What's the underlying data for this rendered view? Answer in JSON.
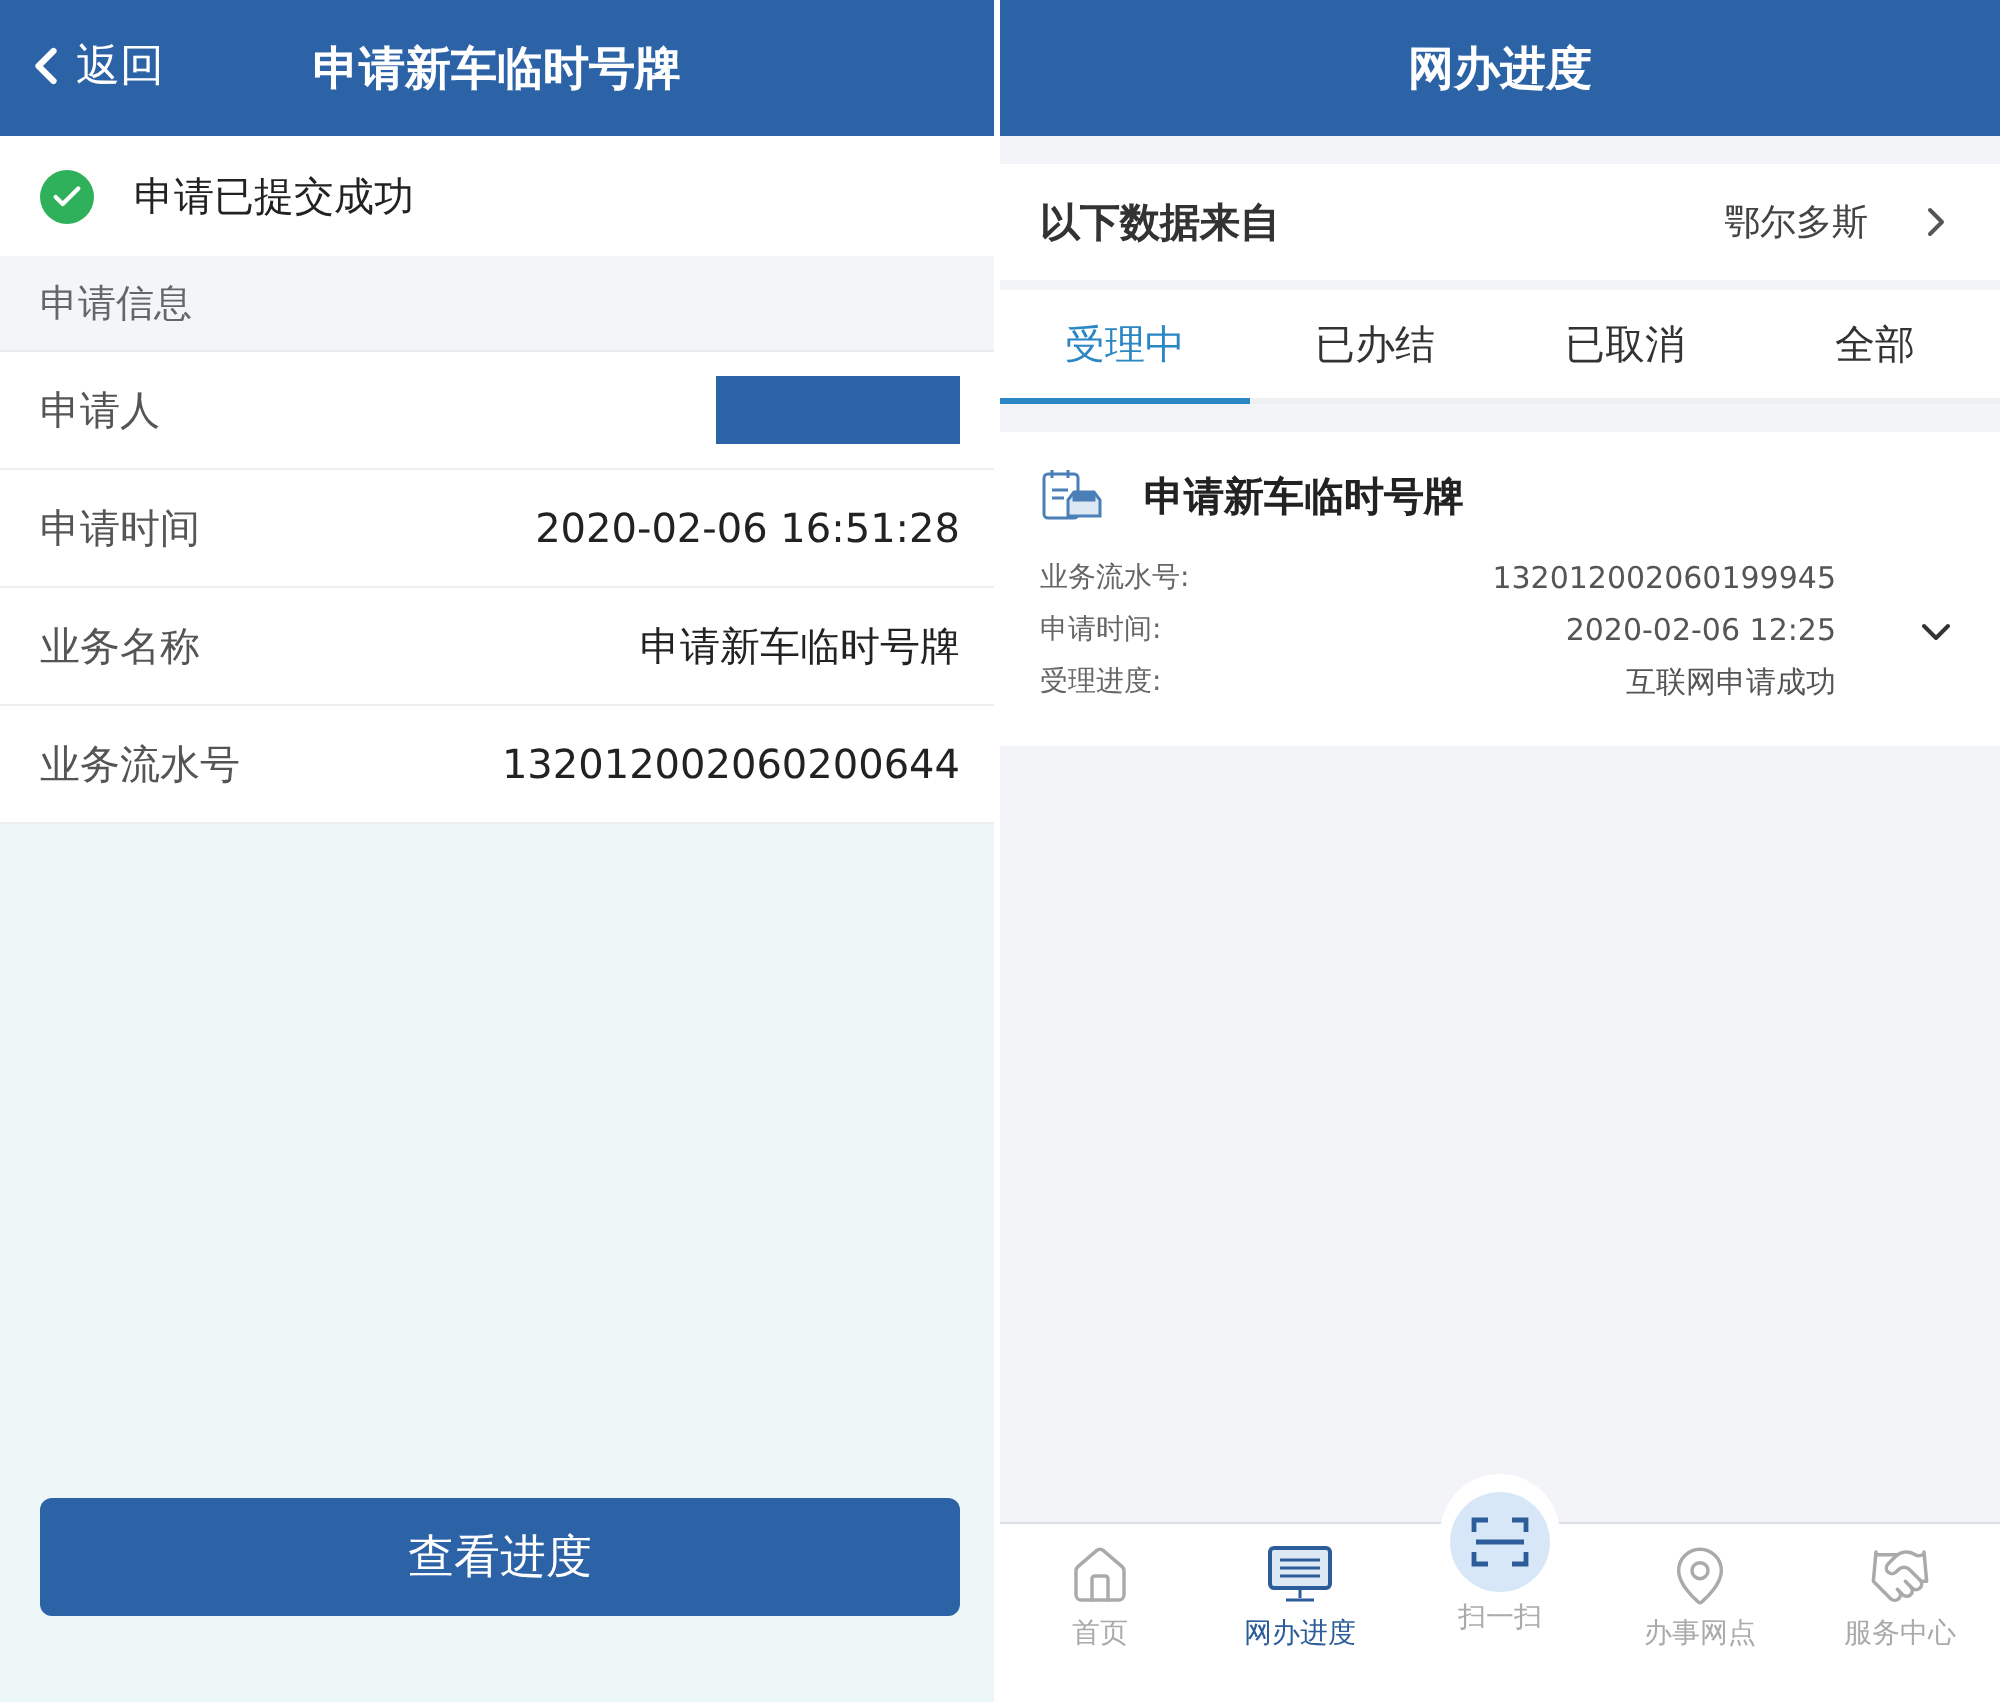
{
  "left": {
    "header": {
      "back": "返回",
      "title": "申请新车临时号牌"
    },
    "status": {
      "text": "申请已提交成功",
      "success": true
    },
    "section": "申请信息",
    "rows": [
      {
        "label": "申请人",
        "kind": "redacted"
      },
      {
        "label": "申请时间",
        "kind": "text",
        "value": "2020-02-06 16:51:28"
      },
      {
        "label": "业务名称",
        "kind": "text",
        "value": "申请新车临时号牌"
      },
      {
        "label": "业务流水号",
        "kind": "text",
        "value": "132012002060200644"
      }
    ],
    "button": "查看进度"
  },
  "right": {
    "header": {
      "title": "网办进度"
    },
    "source": {
      "label": "以下数据来自",
      "value": "鄂尔多斯"
    },
    "tabs": [
      {
        "label": "受理中",
        "selected": true
      },
      {
        "label": "已办结",
        "selected": false
      },
      {
        "label": "已取消",
        "selected": false
      },
      {
        "label": "全部",
        "selected": false
      }
    ],
    "card": {
      "title": "申请新车临时号牌",
      "expanded": false,
      "fields": [
        {
          "label": "业务流水号:",
          "value": "132012002060199945"
        },
        {
          "label": "申请时间:",
          "value": "2020-02-06 12:25"
        },
        {
          "label": "受理进度:",
          "value": "互联网申请成功"
        }
      ]
    },
    "nav": [
      {
        "label": "首页",
        "kind": "home",
        "selected": false
      },
      {
        "label": "网办进度",
        "kind": "monitor",
        "selected": true
      },
      {
        "label": "扫一扫",
        "kind": "scan",
        "selected": false
      },
      {
        "label": "办事网点",
        "kind": "map",
        "selected": false
      },
      {
        "label": "服务中心",
        "kind": "service",
        "selected": false
      }
    ]
  }
}
